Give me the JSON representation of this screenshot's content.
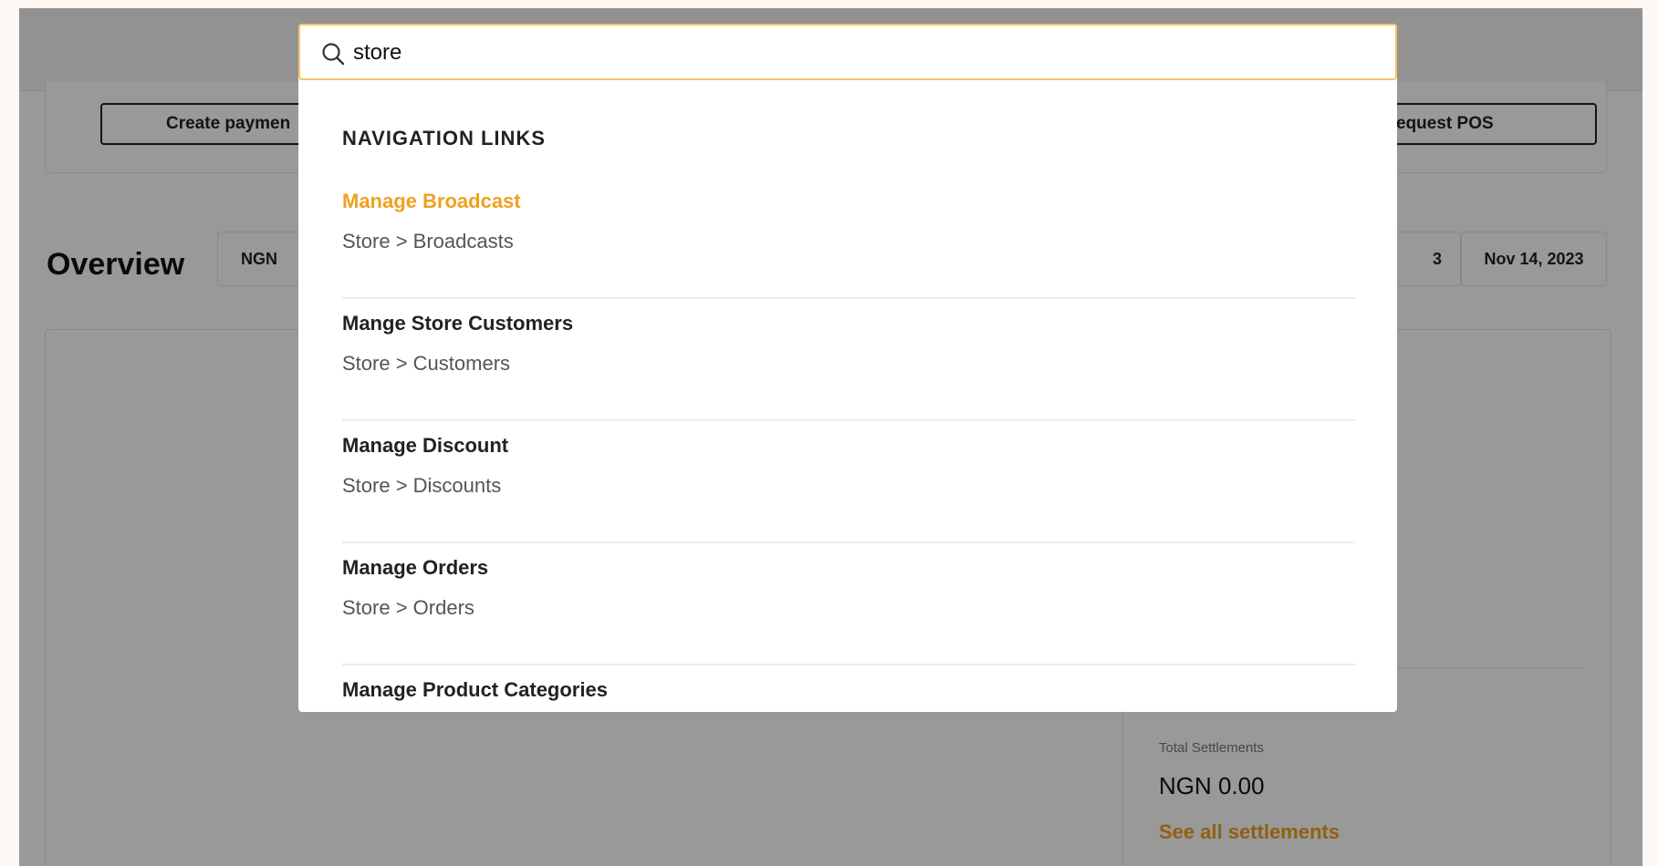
{
  "background": {
    "buttons": {
      "create_payment": "Create paymen",
      "request_pos": "equest POS"
    },
    "overview": {
      "title": "Overview",
      "currency_filter": "NGN",
      "date_start_fragment": "3",
      "date_end": "Nov 14, 2023"
    },
    "settlements": {
      "label": "Total Settlements",
      "value": "NGN 0.00",
      "link": "See all settlements"
    }
  },
  "search": {
    "value": "store",
    "icon": "search-icon",
    "section_heading": "NAVIGATION LINKS",
    "results": [
      {
        "title": "Manage Broadcast",
        "path": "Store > Broadcasts",
        "active": true
      },
      {
        "title": "Mange Store Customers",
        "path": "Store > Customers",
        "active": false
      },
      {
        "title": "Manage Discount",
        "path": "Store > Discounts",
        "active": false
      },
      {
        "title": "Manage Orders",
        "path": "Store > Orders",
        "active": false
      },
      {
        "title": "Manage Product Categories",
        "path": "",
        "active": false
      }
    ]
  },
  "colors": {
    "accent": "#f0a020",
    "search_border": "#f5c469",
    "overlay": "rgba(0,0,0,0.40)"
  }
}
